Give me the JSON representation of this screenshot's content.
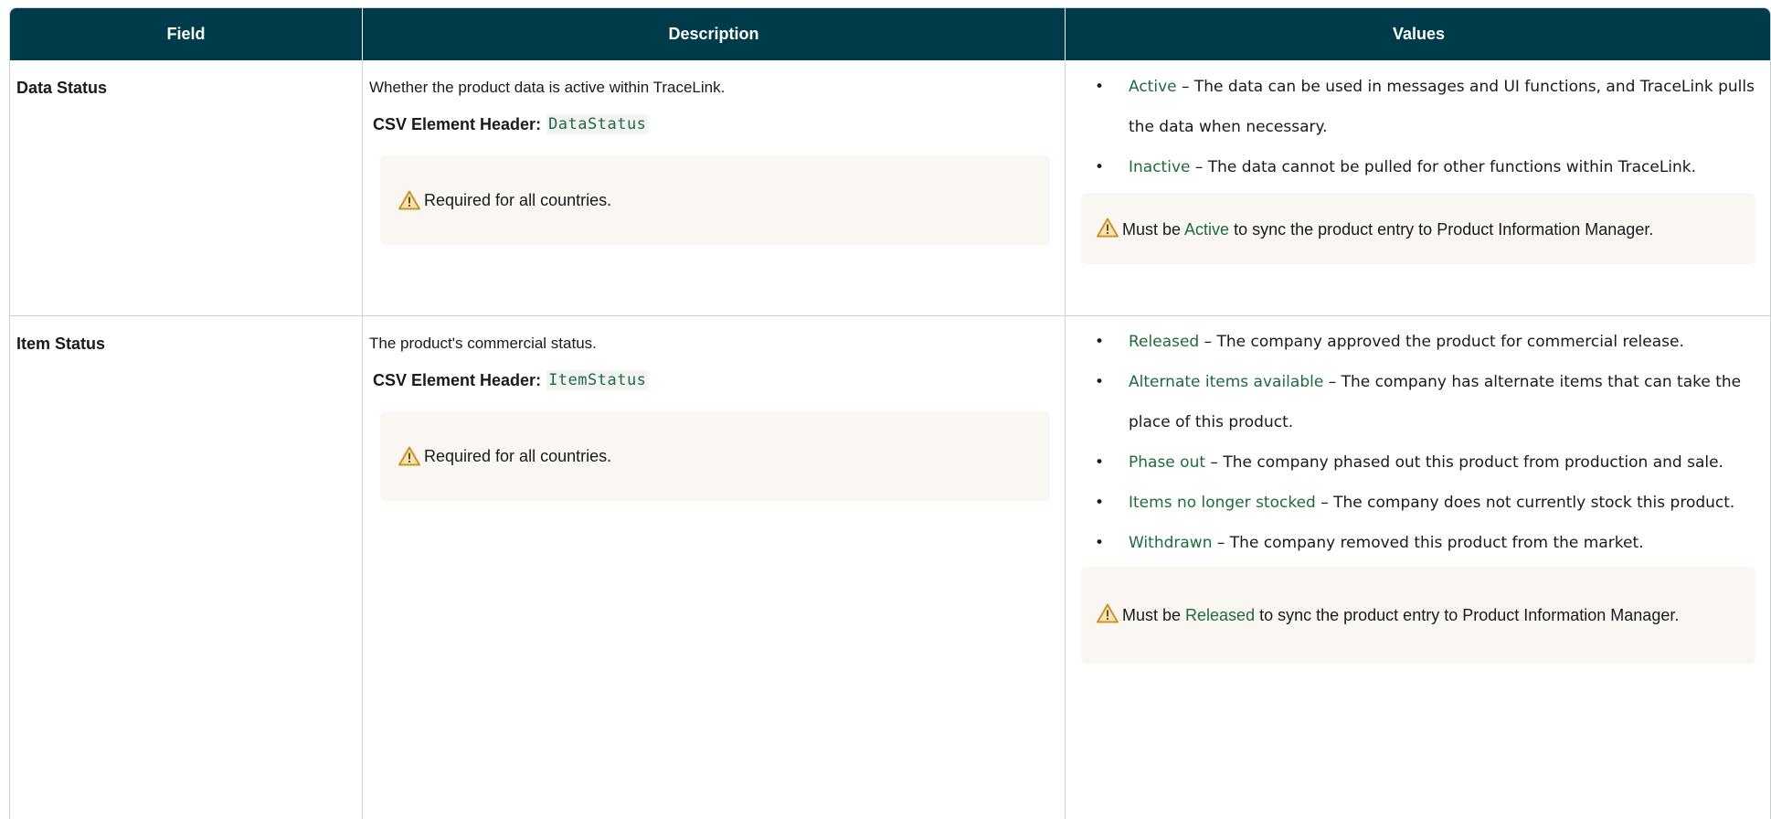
{
  "headers": {
    "field": "Field",
    "description": "Description",
    "values": "Values"
  },
  "rows": [
    {
      "field": "Data Status",
      "description": "Whether the product data is active within TraceLink.",
      "csv_label": "CSV Element Header:",
      "csv_code": "DataStatus",
      "note": "Required for all countries.",
      "values": [
        {
          "term": "Active",
          "text": " – The data can be used in messages and UI functions, and TraceLink pulls the data when necessary."
        },
        {
          "term": "Inactive",
          "text": " – The data cannot be pulled for other functions within TraceLink."
        }
      ],
      "value_note": {
        "before": "Must be ",
        "term": "Active",
        "after": " to sync the product entry to Product Information Manager."
      }
    },
    {
      "field": "Item Status",
      "description": "The product's commercial status.",
      "csv_label": "CSV Element Header:",
      "csv_code": "ItemStatus",
      "note": "Required for all countries.",
      "values": [
        {
          "term": "Released",
          "text": " – The company approved the product for commercial release."
        },
        {
          "term": "Alternate items available",
          "text": " – The company has alternate items that can take the place of this product."
        },
        {
          "term": "Phase out",
          "text": " – The company phased out this product from production and sale."
        },
        {
          "term": "Items no longer stocked",
          "text": " – The company does not currently stock this product."
        },
        {
          "term": "Withdrawn",
          "text": " – The company removed this product from the market."
        }
      ],
      "value_note": {
        "before": "Must be ",
        "term": "Released",
        "after": " to sync the product entry to Product Information Manager."
      }
    }
  ],
  "colors": {
    "header_bg": "#003b4c",
    "term": "#1f6b3d",
    "note_bg": "#faf7f2",
    "warning": "#c9942a"
  },
  "icons": {
    "note_icon": "warning-triangle-icon"
  }
}
